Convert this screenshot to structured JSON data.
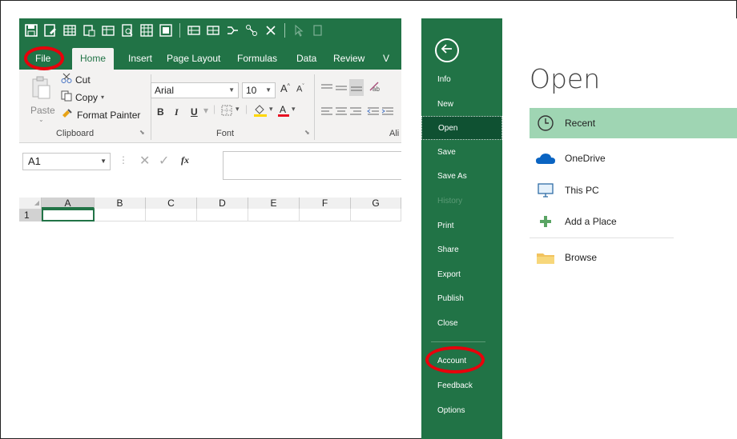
{
  "excel": {
    "tabs": [
      "File",
      "Home",
      "Insert",
      "Page Layout",
      "Formulas",
      "Data",
      "Review",
      "V"
    ],
    "clipboard": {
      "paste_label": "Paste",
      "cut_label": "Cut",
      "copy_label": "Copy",
      "format_painter_label": "Format Painter",
      "group_label": "Clipboard"
    },
    "font": {
      "name": "Arial",
      "size": "10",
      "group_label": "Font",
      "bold": "B",
      "italic": "I",
      "underline": "U"
    },
    "alignment": {
      "group_label": "Ali"
    },
    "formula_bar": {
      "name_box": "A1",
      "fx": "fx"
    },
    "columns": [
      "A",
      "B",
      "C",
      "D",
      "E",
      "F",
      "G"
    ],
    "rows": [
      "1"
    ]
  },
  "backstage": {
    "title": "Open",
    "nav": {
      "info": "Info",
      "new": "New",
      "open": "Open",
      "save": "Save",
      "save_as": "Save As",
      "history": "History",
      "print": "Print",
      "share": "Share",
      "export": "Export",
      "publish": "Publish",
      "close": "Close",
      "account": "Account",
      "feedback": "Feedback",
      "options": "Options"
    },
    "locations": {
      "recent": "Recent",
      "onedrive": "OneDrive",
      "this_pc": "This PC",
      "add_place": "Add a Place",
      "browse": "Browse"
    }
  },
  "colors": {
    "excel_green": "#217346",
    "active_nav": "#0f5132",
    "recent_highlight": "#9fd5b3",
    "annotation_ring": "#e8000b"
  }
}
